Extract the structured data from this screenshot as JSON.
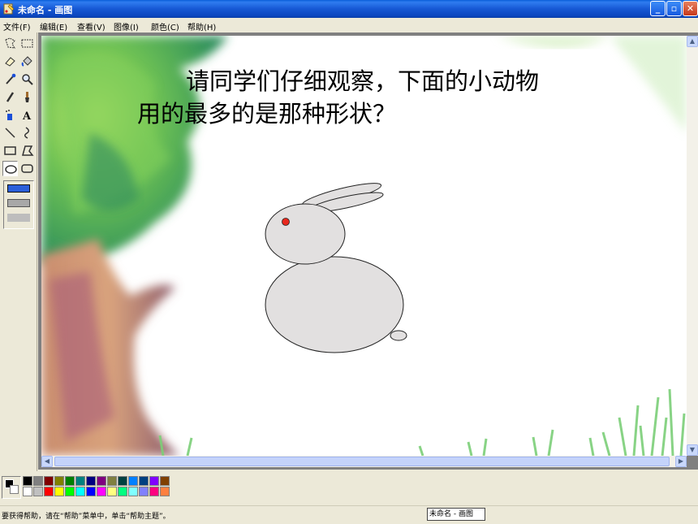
{
  "window": {
    "title": "未命名 - 画图",
    "minimize_icon": "minimize-icon",
    "maximize_icon": "maximize-icon",
    "close_icon": "close-icon"
  },
  "menu": [
    {
      "label": "文件(F)"
    },
    {
      "label": "编辑(E)"
    },
    {
      "label": "查看(V)"
    },
    {
      "label": "图像(I)"
    },
    {
      "label": "颜色(C)"
    },
    {
      "label": "帮助(H)"
    }
  ],
  "tools": [
    "free-form-select-icon",
    "select-icon",
    "eraser-icon",
    "fill-icon",
    "pick-color-icon",
    "magnifier-icon",
    "pencil-icon",
    "brush-icon",
    "airbrush-icon",
    "text-icon",
    "line-icon",
    "curve-icon",
    "rectangle-icon",
    "polygon-icon",
    "ellipse-icon",
    "rounded-rectangle-icon"
  ],
  "canvas": {
    "question_line1": "请同学们仔细观察，下面的小动物",
    "question_line2": "用的最多的是那种形状？",
    "rabbit_eye_color": "#e8281e",
    "rabbit_fill_color": "#e2e0e0"
  },
  "palette": {
    "foreground": "#000000",
    "background": "#ffffff",
    "top_row": [
      "#000000",
      "#808080",
      "#800000",
      "#808000",
      "#008000",
      "#008080",
      "#000080",
      "#800080",
      "#808040",
      "#004040",
      "#0080ff",
      "#004080",
      "#8000ff",
      "#804000"
    ],
    "bottom_row": [
      "#ffffff",
      "#c0c0c0",
      "#ff0000",
      "#ffff00",
      "#00ff00",
      "#00ffff",
      "#0000ff",
      "#ff00ff",
      "#ffff80",
      "#00ff80",
      "#80ffff",
      "#8080ff",
      "#ff0080",
      "#ff8040"
    ]
  },
  "status": {
    "help_text": "要获得帮助，请在“帮助”菜单中，单击“帮助主题”。",
    "taskbar_label": "未命名 - 画图"
  }
}
